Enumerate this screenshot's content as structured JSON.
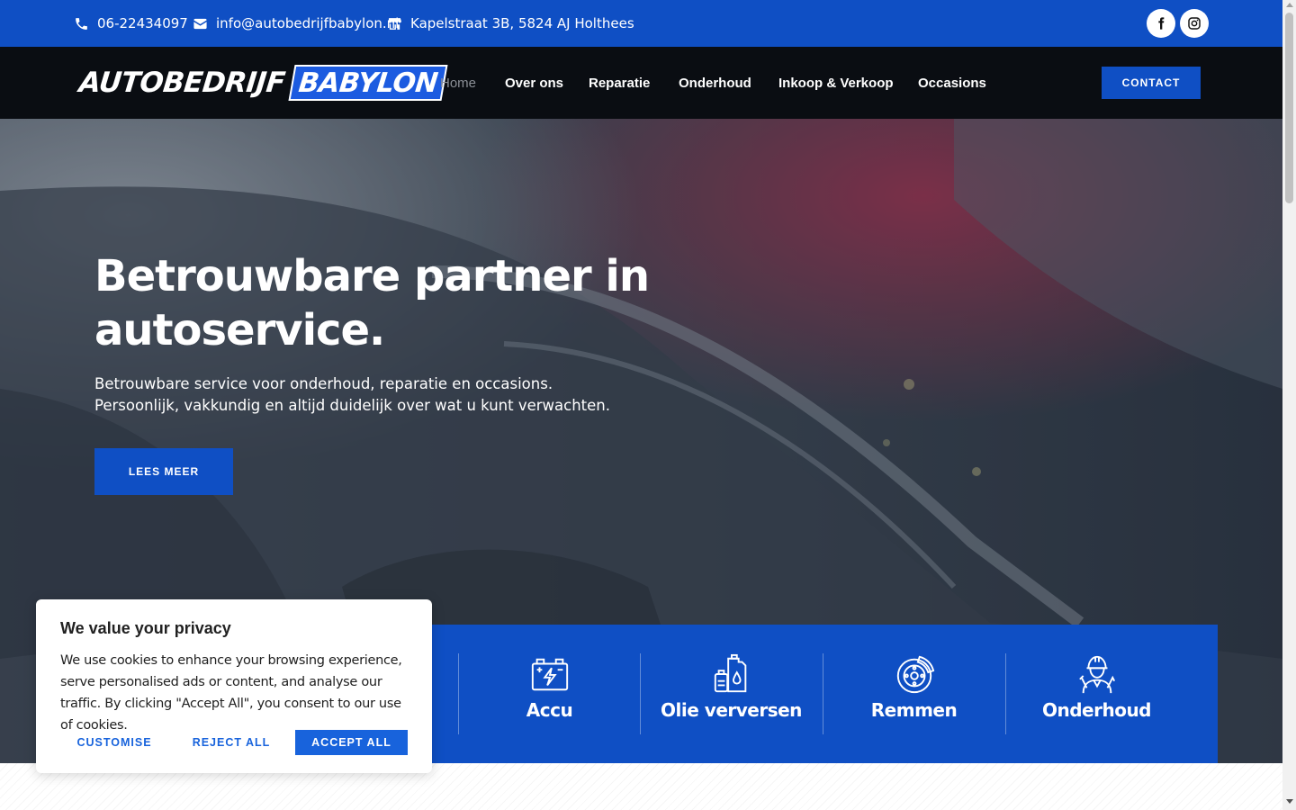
{
  "topbar": {
    "phone": "06-22434097",
    "email": "info@autobedrijfbabylon.nl",
    "address": "Kapelstraat 3B, 5824 AJ Holthees",
    "social": [
      {
        "icon": "facebook-icon"
      },
      {
        "icon": "instagram-icon"
      }
    ]
  },
  "brand": {
    "logo_part1": "AUTOBEDRIJF",
    "logo_part2": "BABYLON"
  },
  "nav": {
    "items": [
      {
        "label": "Home",
        "active": true
      },
      {
        "label": "Over ons"
      },
      {
        "label": "Reparatie"
      },
      {
        "label": "Onderhoud"
      },
      {
        "label": "Inkoop & Verkoop"
      },
      {
        "label": "Occasions"
      }
    ],
    "contact_label": "CONTACT"
  },
  "hero": {
    "title": "Betrouwbare partner in autoservice.",
    "subtitle_line1": "Betrouwbare service voor onderhoud, reparatie en occasions.",
    "subtitle_line2": "Persoonlijk, vakkundig en altijd duidelijk over wat u kunt verwachten.",
    "button_label": "LEES MEER"
  },
  "services": [
    {
      "label": "Accu",
      "icon": "battery-icon"
    },
    {
      "label": "Olie verversen",
      "icon": "oil-icon"
    },
    {
      "label": "Remmen",
      "icon": "brake-disc-icon"
    },
    {
      "label": "Onderhoud",
      "icon": "mechanic-icon"
    }
  ],
  "cookie": {
    "title": "We value your privacy",
    "text": "We use cookies to enhance your browsing experience, serve personalised ads or content, and analyse our traffic. By clicking \"Accept All\", you consent to our use of cookies.",
    "customise_label": "CUSTOMISE",
    "reject_label": "REJECT ALL",
    "accept_label": "ACCEPT ALL"
  },
  "colors": {
    "brand_blue": "#0f4fc4",
    "nav_bg": "#0a0d12",
    "cookie_blue": "#1863dc"
  }
}
